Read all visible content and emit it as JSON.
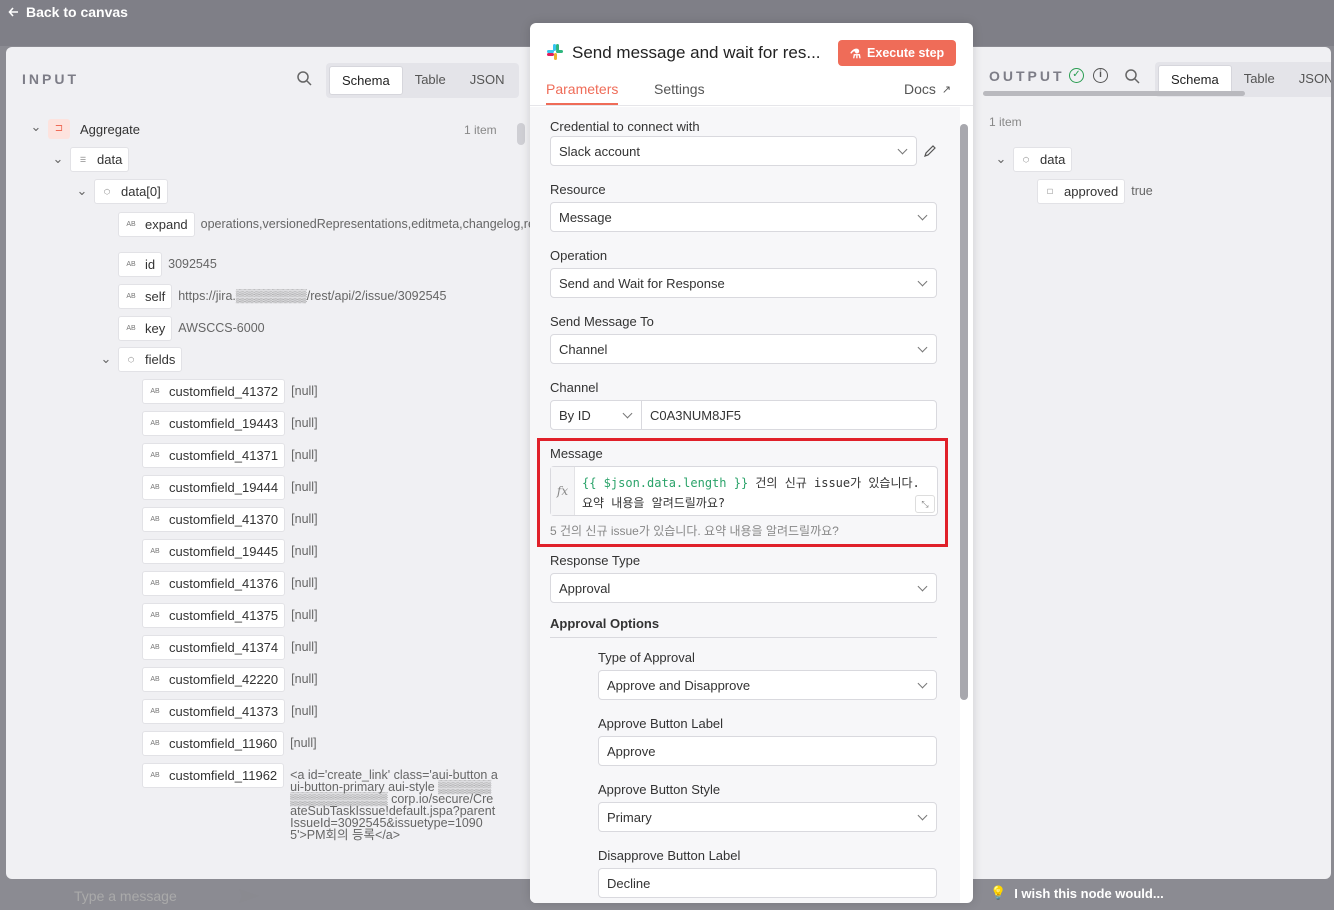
{
  "nav": {
    "back_label": "Back to canvas"
  },
  "input_panel": {
    "title": "INPUT",
    "tabs": [
      "Schema",
      "Table",
      "JSON"
    ],
    "active_tab": "Schema",
    "node_name": "Aggregate",
    "item_count": "1 item",
    "tree": {
      "data": "data",
      "data0": "data[0]",
      "fields_label": "fields",
      "leafs": [
        {
          "key": "expand",
          "value": "operations,versionedRepresentations,editmeta,changelog,renderedFields"
        },
        {
          "key": "id",
          "value": "3092545"
        },
        {
          "key": "self",
          "value": "https://jira.▒▒▒▒▒▒▒▒/rest/api/2/issue/3092545"
        },
        {
          "key": "key",
          "value": "AWSCCS-6000"
        }
      ],
      "custom_fields": [
        {
          "key": "customfield_41372",
          "value": "[null]"
        },
        {
          "key": "customfield_19443",
          "value": "[null]"
        },
        {
          "key": "customfield_41371",
          "value": "[null]"
        },
        {
          "key": "customfield_19444",
          "value": "[null]"
        },
        {
          "key": "customfield_41370",
          "value": "[null]"
        },
        {
          "key": "customfield_19445",
          "value": "[null]"
        },
        {
          "key": "customfield_41376",
          "value": "[null]"
        },
        {
          "key": "customfield_41375",
          "value": "[null]"
        },
        {
          "key": "customfield_41374",
          "value": "[null]"
        },
        {
          "key": "customfield_42220",
          "value": "[null]"
        },
        {
          "key": "customfield_41373",
          "value": "[null]"
        },
        {
          "key": "customfield_11960",
          "value": "[null]"
        },
        {
          "key": "customfield_11962",
          "value": "<a id='create_link' class='aui-button aui-button-primary aui-style ▒▒▒▒▒▒▒▒▒▒▒▒▒▒▒▒▒ corp.io/secure/CreateSubTaskIssue!default.jspa?parentIssueId=3092545&issuetype=10905'>PM회의 등록</a>"
        }
      ]
    },
    "chat_placeholder": "Type a message"
  },
  "ndv": {
    "title": "Send message and wait for res...",
    "execute_label": "Execute step",
    "tabs": [
      "Parameters",
      "Settings"
    ],
    "active_tab": "Parameters",
    "docs_label": "Docs",
    "params": {
      "credential_label": "Credential to connect with",
      "credential_value": "Slack account",
      "resource_label": "Resource",
      "resource_value": "Message",
      "operation_label": "Operation",
      "operation_value": "Send and Wait for Response",
      "send_to_label": "Send Message To",
      "send_to_value": "Channel",
      "channel_label": "Channel",
      "channel_mode": "By ID",
      "channel_value": "C0A3NUM8JF5",
      "message_label": "Message",
      "message_expr_code": "{{ $json.data.length }}",
      "message_expr_text1": " 건의 신규 issue가 있습니다.",
      "message_expr_text2": "요약 내용을 알려드릴까요?",
      "message_preview": "5 건의 신규 issue가 있습니다. 요약 내용을 알려드릴까요?",
      "response_type_label": "Response Type",
      "response_type_value": "Approval",
      "approval_options_label": "Approval Options",
      "type_of_approval_label": "Type of Approval",
      "type_of_approval_value": "Approve and Disapprove",
      "approve_label_label": "Approve Button Label",
      "approve_label_value": "Approve",
      "approve_style_label": "Approve Button Style",
      "approve_style_value": "Primary",
      "disapprove_label_label": "Disapprove Button Label",
      "disapprove_label_value": "Decline"
    }
  },
  "output_panel": {
    "title": "OUTPUT",
    "tabs": [
      "Schema",
      "Table",
      "JSON"
    ],
    "active_tab": "Schema",
    "item_count": "1 item",
    "data_label": "data",
    "approved_key": "approved",
    "approved_value": "true"
  },
  "feedback": {
    "label": "I wish this node would..."
  },
  "colors": {
    "accent": "#ef6c58",
    "highlight": "#e0202a",
    "success": "#2a9d52",
    "code": "#2ba36a"
  }
}
